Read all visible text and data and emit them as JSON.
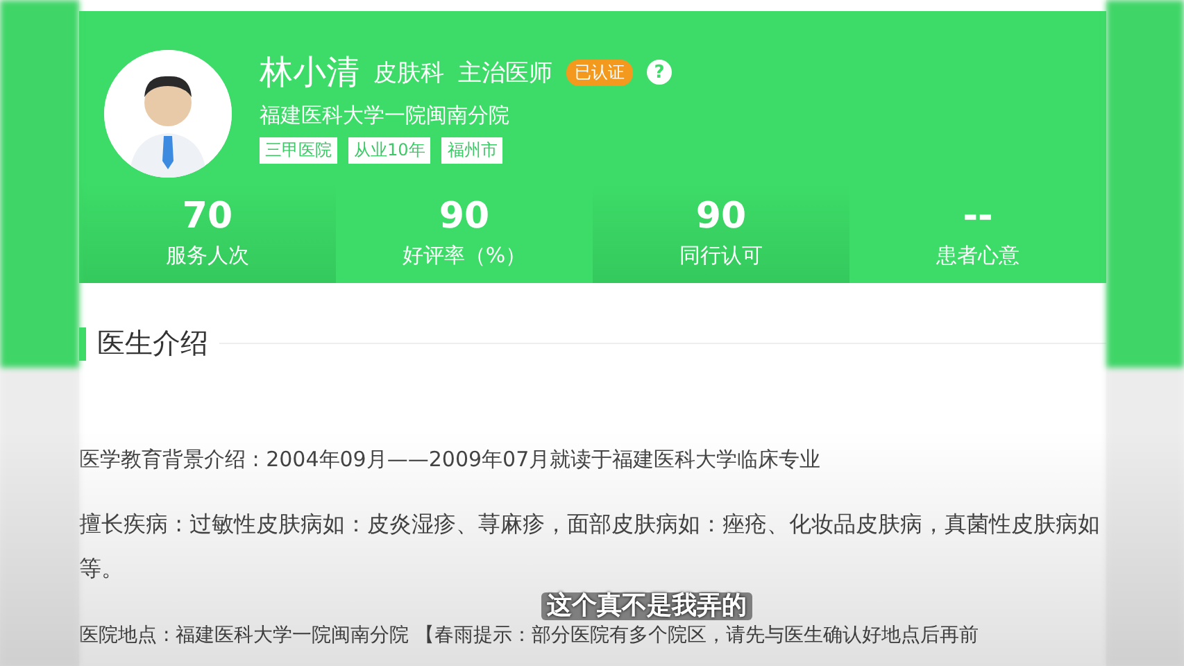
{
  "doctor": {
    "name": "林小清",
    "department": "皮肤科",
    "title": "主治医师",
    "badge": "已认证",
    "help": "?",
    "hospital": "福建医科大学一院闽南分院",
    "tags": [
      "三甲医院",
      "从业10年",
      "福州市"
    ]
  },
  "stats": [
    {
      "value": "70",
      "label": "服务人次"
    },
    {
      "value": "90",
      "label": "好评率（%）"
    },
    {
      "value": "90",
      "label": "同行认可"
    },
    {
      "value": "--",
      "label": "患者心意"
    }
  ],
  "section": {
    "title": "医生介绍",
    "paragraphs": [
      "医学教育背景介绍 : 2004年09月——2009年07月就读于福建医科大学临床专业",
      "擅长疾病 : 过敏性皮肤病如：皮炎湿疹、荨麻疹，面部皮肤病如：痤疮、化妆品皮肤病，真菌性皮肤病如等。",
      "医院地点 : 福建医科大学一院闽南分院 【春雨提示：部分医院有多个院区，请先与医生确认好地点后再前"
    ]
  },
  "subtitle": "这个真不是我弄的"
}
